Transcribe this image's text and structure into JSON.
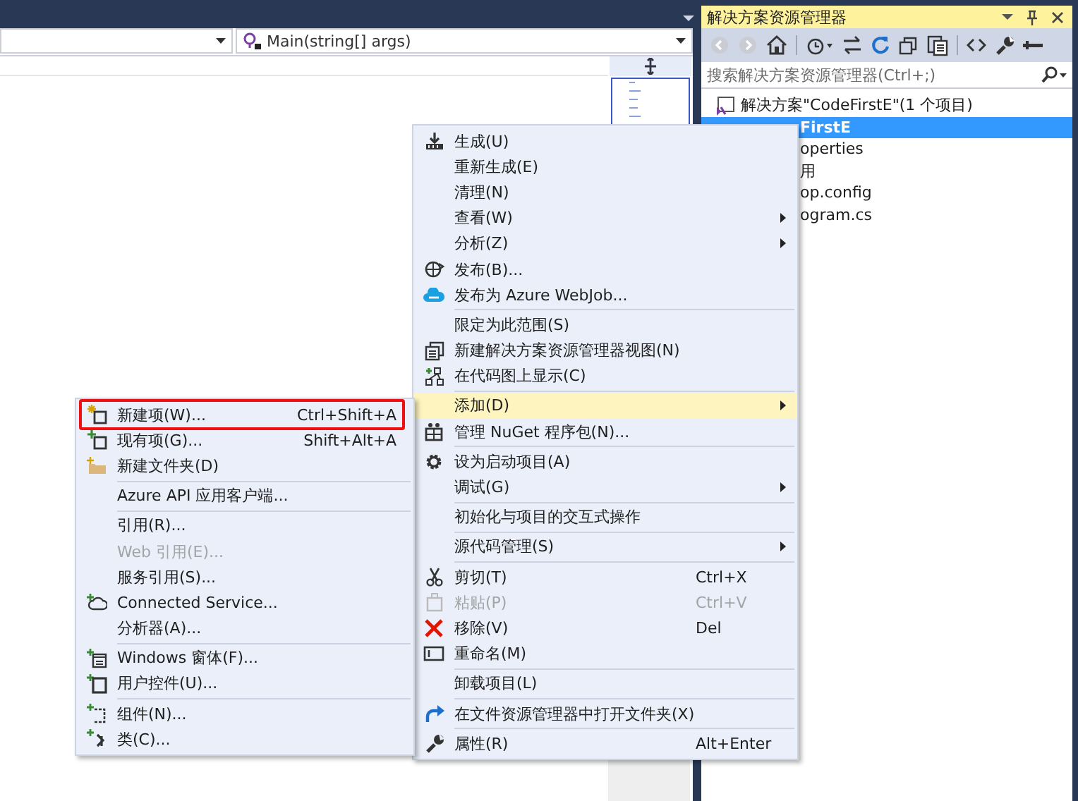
{
  "editor": {
    "member_combo": {
      "value": "Main(string[] args)"
    }
  },
  "solution_explorer": {
    "title": "解决方案资源管理器",
    "search": {
      "placeholder": "搜索解决方案资源管理器(Ctrl+;)"
    },
    "tree": [
      {
        "label": "解决方案\"CodeFirstE\"(1 个项目)",
        "selected": false,
        "children": [
          {
            "label": "FirstE",
            "selected": true,
            "children": [
              {
                "label": "operties",
                "selected": false
              },
              {
                "label": "用",
                "selected": false
              },
              {
                "label": "op.config",
                "selected": false
              },
              {
                "label": "ogram.cs",
                "selected": false
              }
            ]
          }
        ]
      }
    ]
  },
  "context_menu": {
    "items": [
      {
        "kind": "item",
        "label": "生成(U)",
        "submenu": false,
        "disabled": false,
        "selected": false
      },
      {
        "kind": "item",
        "label": "重新生成(E)",
        "submenu": false,
        "disabled": false,
        "selected": false
      },
      {
        "kind": "item",
        "label": "清理(N)",
        "submenu": false,
        "disabled": false,
        "selected": false
      },
      {
        "kind": "item",
        "label": "查看(W)",
        "submenu": true,
        "disabled": false,
        "selected": false
      },
      {
        "kind": "item",
        "label": "分析(Z)",
        "submenu": true,
        "disabled": false,
        "selected": false
      },
      {
        "kind": "item",
        "label": "发布(B)...",
        "submenu": false,
        "disabled": false,
        "selected": false
      },
      {
        "kind": "item",
        "label": "发布为 Azure WebJob...",
        "submenu": false,
        "disabled": false,
        "selected": false
      },
      {
        "kind": "separator"
      },
      {
        "kind": "item",
        "label": "限定为此范围(S)",
        "submenu": false,
        "disabled": false,
        "selected": false
      },
      {
        "kind": "item",
        "label": "新建解决方案资源管理器视图(N)",
        "submenu": false,
        "disabled": false,
        "selected": false
      },
      {
        "kind": "item",
        "label": "在代码图上显示(C)",
        "submenu": false,
        "disabled": false,
        "selected": false
      },
      {
        "kind": "separator"
      },
      {
        "kind": "item",
        "label": "添加(D)",
        "submenu": true,
        "disabled": false,
        "selected": true
      },
      {
        "kind": "item",
        "label": "管理 NuGet 程序包(N)...",
        "submenu": false,
        "disabled": false,
        "selected": false
      },
      {
        "kind": "separator"
      },
      {
        "kind": "item",
        "label": "设为启动项目(A)",
        "submenu": false,
        "disabled": false,
        "selected": false
      },
      {
        "kind": "item",
        "label": "调试(G)",
        "submenu": true,
        "disabled": false,
        "selected": false
      },
      {
        "kind": "separator"
      },
      {
        "kind": "item",
        "label": "初始化与项目的交互式操作",
        "submenu": false,
        "disabled": false,
        "selected": false
      },
      {
        "kind": "separator"
      },
      {
        "kind": "item",
        "label": "源代码管理(S)",
        "submenu": true,
        "disabled": false,
        "selected": false
      },
      {
        "kind": "separator"
      },
      {
        "kind": "item",
        "label": "剪切(T)",
        "shortcut": "Ctrl+X",
        "submenu": false,
        "disabled": false,
        "selected": false
      },
      {
        "kind": "item",
        "label": "粘贴(P)",
        "shortcut": "Ctrl+V",
        "submenu": false,
        "disabled": true,
        "selected": false
      },
      {
        "kind": "item",
        "label": "移除(V)",
        "shortcut": "Del",
        "submenu": false,
        "disabled": false,
        "selected": false
      },
      {
        "kind": "item",
        "label": "重命名(M)",
        "submenu": false,
        "disabled": false,
        "selected": false
      },
      {
        "kind": "separator"
      },
      {
        "kind": "item",
        "label": "卸载项目(L)",
        "submenu": false,
        "disabled": false,
        "selected": false
      },
      {
        "kind": "separator"
      },
      {
        "kind": "item",
        "label": "在文件资源管理器中打开文件夹(X)",
        "submenu": false,
        "disabled": false,
        "selected": false
      },
      {
        "kind": "separator"
      },
      {
        "kind": "item",
        "label": "属性(R)",
        "shortcut": "Alt+Enter",
        "submenu": false,
        "disabled": false,
        "selected": false
      }
    ]
  },
  "add_submenu": {
    "items": [
      {
        "kind": "item",
        "label": "新建项(W)...",
        "shortcut": "Ctrl+Shift+A",
        "disabled": false,
        "marked": true
      },
      {
        "kind": "item",
        "label": "现有项(G)...",
        "shortcut": "Shift+Alt+A",
        "disabled": false,
        "marked": false
      },
      {
        "kind": "item",
        "label": "新建文件夹(D)",
        "disabled": false,
        "marked": false
      },
      {
        "kind": "separator"
      },
      {
        "kind": "item",
        "label": "Azure API 应用客户端...",
        "disabled": false,
        "marked": false
      },
      {
        "kind": "separator"
      },
      {
        "kind": "item",
        "label": "引用(R)...",
        "disabled": false,
        "marked": false
      },
      {
        "kind": "item",
        "label": "Web 引用(E)...",
        "disabled": true,
        "marked": false
      },
      {
        "kind": "item",
        "label": "服务引用(S)...",
        "disabled": false,
        "marked": false
      },
      {
        "kind": "item",
        "label": "Connected Service...",
        "disabled": false,
        "marked": false
      },
      {
        "kind": "item",
        "label": "分析器(A)...",
        "disabled": false,
        "marked": false
      },
      {
        "kind": "separator"
      },
      {
        "kind": "item",
        "label": "Windows 窗体(F)...",
        "disabled": false,
        "marked": false
      },
      {
        "kind": "item",
        "label": "用户控件(U)...",
        "disabled": false,
        "marked": false
      },
      {
        "kind": "separator"
      },
      {
        "kind": "item",
        "label": "组件(N)...",
        "disabled": false,
        "marked": false
      },
      {
        "kind": "item",
        "label": "类(C)...",
        "disabled": false,
        "marked": false
      }
    ]
  }
}
